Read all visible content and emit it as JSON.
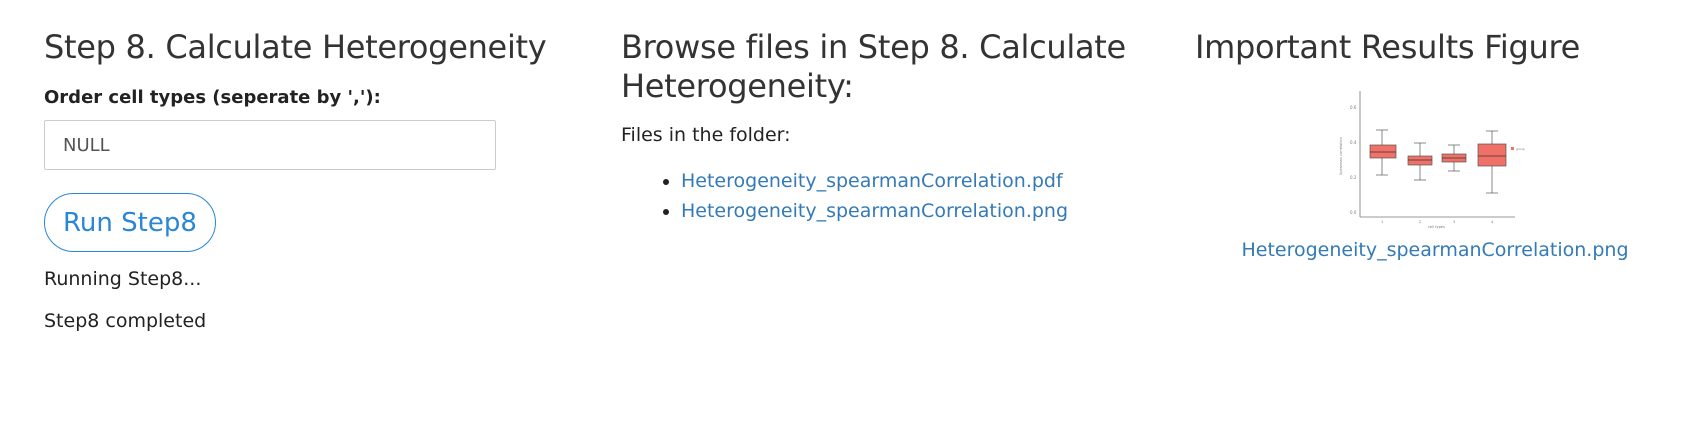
{
  "step": {
    "title": "Step 8. Calculate Heterogeneity",
    "order_label": "Order cell types (seperate by ','):",
    "order_value": "NULL",
    "run_button_label": "Run Step8",
    "status_lines": [
      "Running Step8...",
      "Step8 completed"
    ]
  },
  "browse": {
    "title": "Browse files in Step 8. Calculate Heterogeneity:",
    "files_label": "Files in the folder:",
    "files": [
      "Heterogeneity_spearmanCorrelation.pdf",
      "Heterogeneity_spearmanCorrelation.png"
    ]
  },
  "results": {
    "title": "Important Results Figure",
    "figure_link": "Heterogeneity_spearmanCorrelation.png",
    "figure_box_color": "#f07167"
  },
  "colors": {
    "link": "#337ab7",
    "button_accent": "#2a86d6"
  }
}
